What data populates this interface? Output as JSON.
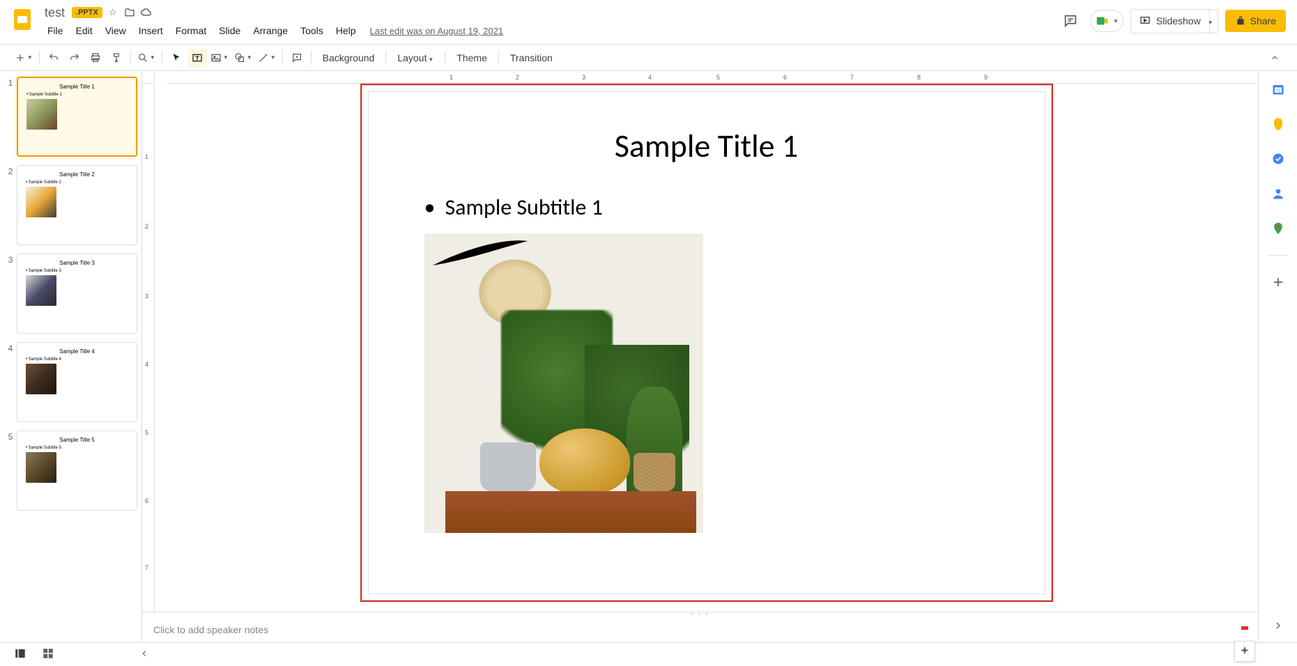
{
  "doc": {
    "title": "test",
    "badge": ".PPTX",
    "lastEdit": "Last edit was on August 19, 2021"
  },
  "menus": {
    "file": "File",
    "edit": "Edit",
    "view": "View",
    "insert": "Insert",
    "format": "Format",
    "slide": "Slide",
    "arrange": "Arrange",
    "tools": "Tools",
    "help": "Help"
  },
  "header": {
    "slideshow": "Slideshow",
    "share": "Share"
  },
  "toolbar": {
    "background": "Background",
    "layout": "Layout",
    "theme": "Theme",
    "transition": "Transition"
  },
  "ruler": {
    "h": [
      "1",
      "2",
      "3",
      "4",
      "5",
      "6",
      "7",
      "8",
      "9"
    ],
    "v": [
      "1",
      "2",
      "3",
      "4",
      "5",
      "6",
      "7"
    ]
  },
  "slides": [
    {
      "num": "1",
      "title": "Sample Title 1",
      "subtitle": "Sample Subtitle 1",
      "selected": true
    },
    {
      "num": "2",
      "title": "Sample Title 2",
      "subtitle": "Sample Subtitle 2",
      "selected": false
    },
    {
      "num": "3",
      "title": "Sample Title 3",
      "subtitle": "Sample Subtitle 3",
      "selected": false
    },
    {
      "num": "4",
      "title": "Sample Title 4",
      "subtitle": "Sample Subtitle 4",
      "selected": false
    },
    {
      "num": "5",
      "title": "Sample Title 5",
      "subtitle": "Sample Subtitle 5",
      "selected": false
    }
  ],
  "currentSlide": {
    "title": "Sample Title 1",
    "subtitle": "Sample Subtitle 1"
  },
  "notes": {
    "placeholder": "Click to add speaker notes"
  }
}
